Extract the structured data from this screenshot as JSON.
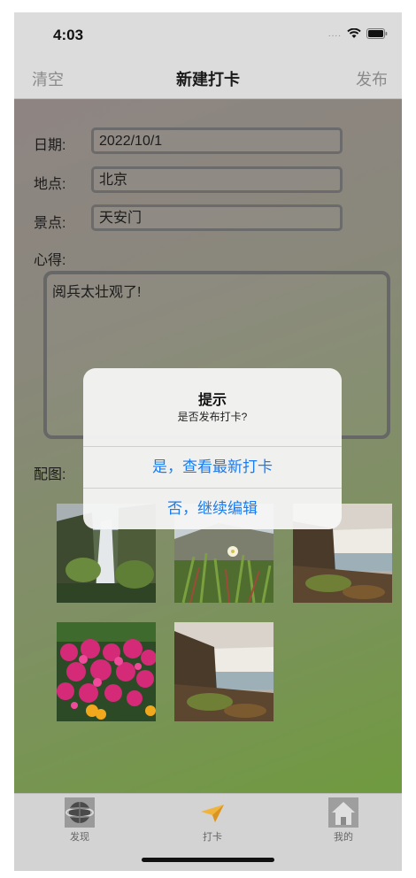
{
  "status_bar": {
    "time": "4:03",
    "signal": "....",
    "icons": [
      "wifi-icon",
      "battery-icon"
    ]
  },
  "nav": {
    "left_label": "清空",
    "title": "新建打卡",
    "right_label": "发布"
  },
  "form": {
    "date": {
      "label": "日期:",
      "value": "2022/10/1"
    },
    "place": {
      "label": "地点:",
      "value": "北京"
    },
    "scenic_spot": {
      "label": "景点:",
      "value": "天安门"
    },
    "notes": {
      "label": "心得:",
      "value": "阅兵太壮观了!"
    },
    "images": {
      "label": "配图:"
    }
  },
  "photos": [
    {
      "name": "waterfall-cliff-photo"
    },
    {
      "name": "white-flower-grass-photo"
    },
    {
      "name": "waterfall-rocks-photo"
    },
    {
      "name": "pink-flowers-photo"
    },
    {
      "name": "waterfall-rocks-photo-2"
    }
  ],
  "alert": {
    "title": "提示",
    "message": "是否发布打卡?",
    "confirm_label": "是，查看最新打卡",
    "cancel_label": "否，继续编辑"
  },
  "tabs": [
    {
      "label": "发现",
      "icon": "globe-icon"
    },
    {
      "label": "打卡",
      "icon": "paper-plane-icon"
    },
    {
      "label": "我的",
      "icon": "home-icon"
    }
  ],
  "colors": {
    "accent": "#1a7cf0",
    "plane": "#f0b43c"
  }
}
